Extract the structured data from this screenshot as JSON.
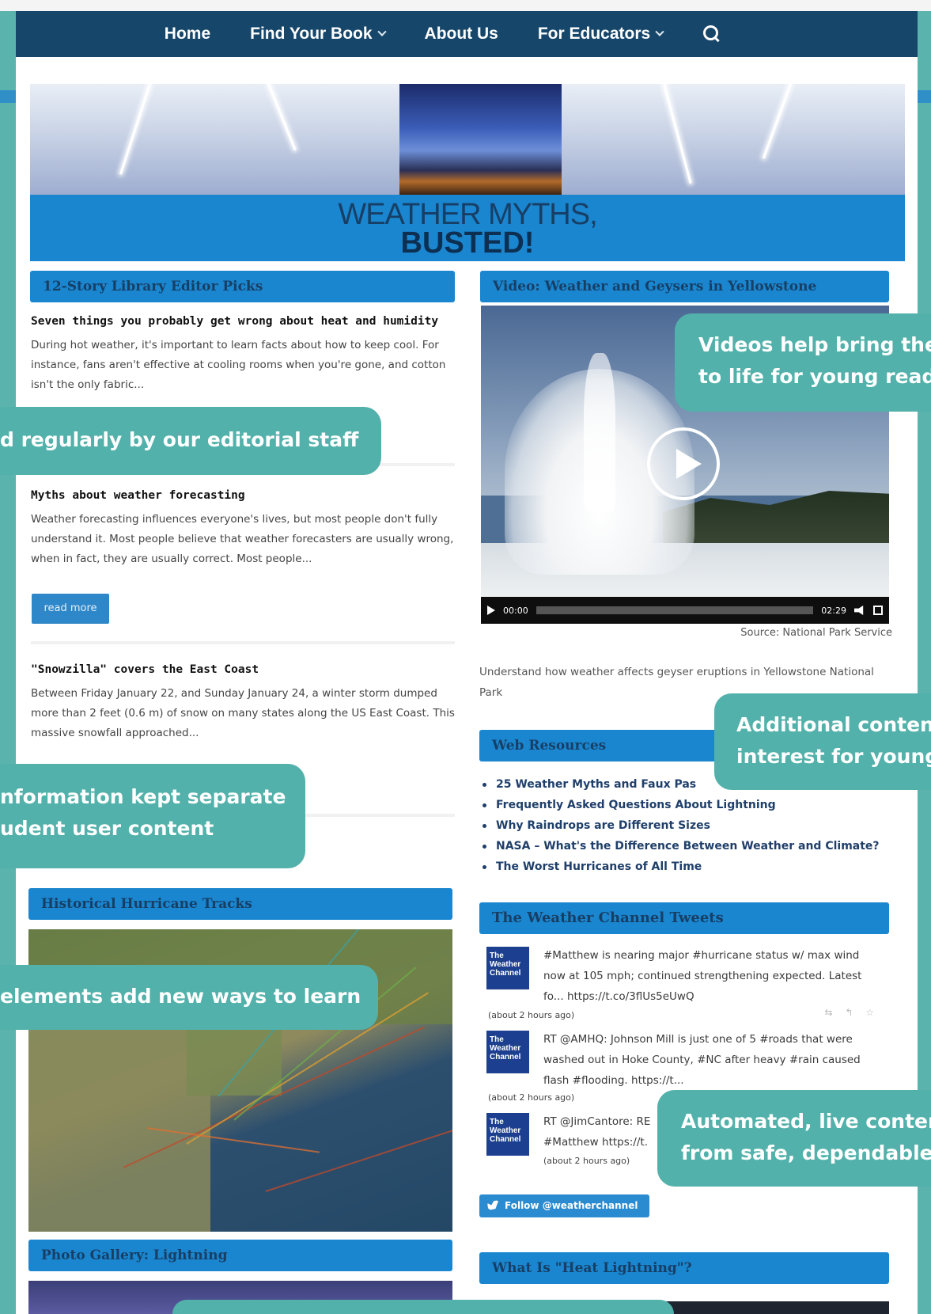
{
  "nav": {
    "items": [
      {
        "label": "Home",
        "dropdown": false
      },
      {
        "label": "Find Your Book",
        "dropdown": true
      },
      {
        "label": "About Us",
        "dropdown": false
      },
      {
        "label": "For Educators",
        "dropdown": true
      }
    ],
    "search_icon": "search-icon"
  },
  "banner": {
    "title": "WEATHER MYTHS,",
    "subtitle": "BUSTED!"
  },
  "editor_picks": {
    "heading": "12-Story Library Editor Picks",
    "articles": [
      {
        "title": "Seven things you probably get wrong about heat and humidity",
        "body": "During hot weather, it's important to learn facts about how to keep cool. For instance, fans aren't effective at cooling rooms when you're gone, and cotton isn't the only fabric..."
      },
      {
        "title": "Myths about weather forecasting",
        "body": "Weather forecasting influences everyone's lives, but most people don't fully understand it. Most people believe that weather forecasters are usually wrong, when in fact, they are usually correct. Most people..."
      },
      {
        "title": "\"Snowzilla\" covers the East Coast",
        "body": "Between Friday January 22, and Sunday January 24, a winter storm dumped more than 2 feet (0.6 m) of snow on many states along the US East Coast. This massive snowfall approached..."
      }
    ],
    "read_more": "read more"
  },
  "video": {
    "heading": "Video: Weather and Geysers in Yellowstone",
    "time_current": "00:00",
    "time_total": "02:29",
    "source": "Source: National Park Service",
    "description": "Understand how weather affects geyser eruptions in Yellowstone National Park"
  },
  "web_resources": {
    "heading": "Web Resources",
    "links": [
      "25 Weather Myths and Faux Pas",
      "Frequently Asked Questions About Lightning",
      "Why Raindrops are Different Sizes",
      "NASA – What's the Difference Between Weather and Climate?",
      "The Worst Hurricanes of All Time"
    ]
  },
  "tweets": {
    "heading": "The Weather Channel Tweets",
    "logo_text": [
      "The",
      "Weather",
      "Channel"
    ],
    "items": [
      {
        "text": "#Matthew is nearing major #hurricane status w/ max wind now at 105 mph; continued strengthening expected. Latest fo... https://t.co/3flUs5eUwQ",
        "time": "(about 2 hours ago)"
      },
      {
        "text": "RT @AMHQ: Johnson Mill is just one of 5 #roads that were washed out in Hoke County, #NC after heavy #rain caused flash #flooding. https://t...",
        "time": "(about 2 hours ago)"
      },
      {
        "text": "RT @JimCantore: RE #Matthew https://t.",
        "time": "(about 2 hours ago)"
      }
    ],
    "action_icons": "⇆ ↰ ☆",
    "follow_label": "Follow @weatherchannel"
  },
  "hurricane": {
    "heading": "Historical Hurricane Tracks"
  },
  "gallery": {
    "heading": "Photo Gallery: Lightning"
  },
  "heat_lightning": {
    "heading": "What Is \"Heat Lightning\"?"
  },
  "callouts": {
    "videos": [
      "Videos help bring the",
      "to life for young read"
    ],
    "editorial": "d regularly by our editorial staff",
    "additional": [
      "Additional conten",
      "interest for young"
    ],
    "separate": [
      "nformation kept separate",
      "udent user content"
    ],
    "elements": "elements add new ways to learn",
    "automated": [
      "Automated, live conter",
      "from safe, dependable"
    ]
  },
  "colors": {
    "nav_bg": "#16466a",
    "section_head": "#1a86cf",
    "callout": "#52b1aa",
    "background": "#5ab3ad"
  }
}
